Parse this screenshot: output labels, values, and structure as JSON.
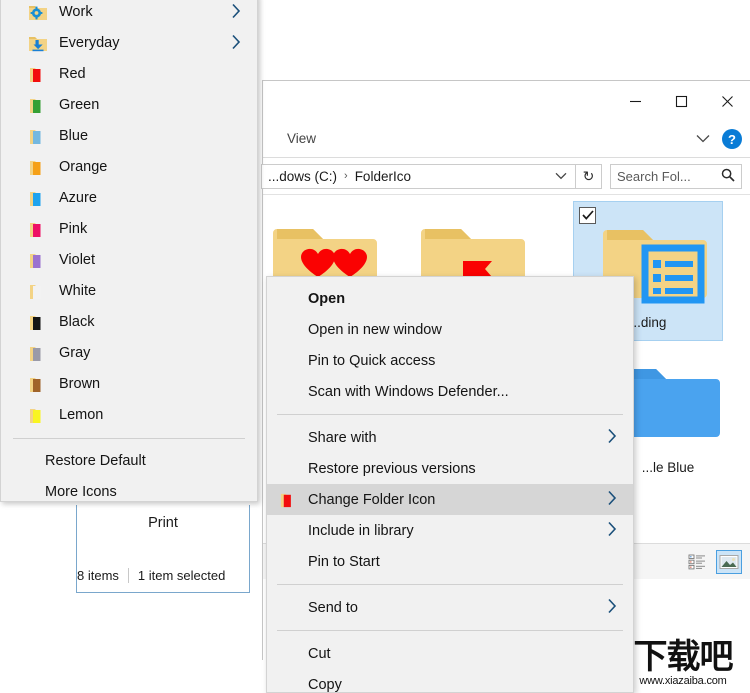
{
  "explorer": {
    "window_buttons": {
      "minimize": "minimize",
      "maximize": "maximize",
      "close": "close"
    },
    "ribbon": {
      "tab_view": "View",
      "help_label": "?"
    },
    "address": {
      "crumb1": "...dows (C:)",
      "crumb2": "FolderIco",
      "separator": "›",
      "refresh_label": "↻"
    },
    "search": {
      "placeholder": "Search Fol...",
      "icon": "search-icon"
    },
    "files": [
      {
        "label": "",
        "icon": "folder-heart-red",
        "selected": false
      },
      {
        "label": "",
        "icon": "folder-flag-red",
        "selected": false
      },
      {
        "label": "...ding",
        "icon": "folder-reading-blue",
        "selected": true
      },
      {
        "label": "...le Blue",
        "icon": "folder-plain-blue",
        "selected": false
      }
    ],
    "status": {
      "item_count": "8 items",
      "selection": "1 item selected"
    },
    "view_buttons": {
      "details_view": "details-view-icon",
      "large_icons_view": "large-icons-view-icon"
    }
  },
  "left_menu": {
    "items": [
      {
        "label": "Work",
        "icon": "folder-gear-yellow",
        "color": "#2f8fd4",
        "submenu": true
      },
      {
        "label": "Everyday",
        "icon": "folder-download",
        "color": "#1a7fd4",
        "submenu": true
      },
      {
        "label": "Red",
        "icon": "folder-color",
        "color": "#f20d0d",
        "submenu": false
      },
      {
        "label": "Green",
        "icon": "folder-color",
        "color": "#35a035",
        "submenu": false
      },
      {
        "label": "Blue",
        "icon": "folder-color",
        "color": "#74b8e0",
        "submenu": false
      },
      {
        "label": "Orange",
        "icon": "folder-color",
        "color": "#f5a017",
        "submenu": false
      },
      {
        "label": "Azure",
        "icon": "folder-color",
        "color": "#1fa3ee",
        "submenu": false
      },
      {
        "label": "Pink",
        "icon": "folder-color",
        "color": "#ee1064",
        "submenu": false
      },
      {
        "label": "Violet",
        "icon": "folder-color",
        "color": "#9b72d0",
        "submenu": false
      },
      {
        "label": "White",
        "icon": "folder-color",
        "color": "#f2f2f2",
        "submenu": false
      },
      {
        "label": "Black",
        "icon": "folder-color",
        "color": "#141414",
        "submenu": false
      },
      {
        "label": "Gray",
        "icon": "folder-color",
        "color": "#9a9aa8",
        "submenu": false
      },
      {
        "label": "Brown",
        "icon": "folder-color",
        "color": "#a0632a",
        "submenu": false
      },
      {
        "label": "Lemon",
        "icon": "folder-color",
        "color": "#f9f520",
        "submenu": false
      }
    ],
    "footer_items": [
      {
        "label": "Restore Default"
      },
      {
        "label": "More Icons"
      }
    ]
  },
  "behind_window": {
    "print_label": "Print",
    "item_count": "8 items",
    "selection": "1 item selected"
  },
  "context_menu": {
    "groups": [
      {
        "items": [
          {
            "label": "Open",
            "bold": true,
            "submenu": false,
            "icon": null,
            "highlighted": false
          },
          {
            "label": "Open in new window",
            "bold": false,
            "submenu": false,
            "icon": null,
            "highlighted": false
          },
          {
            "label": "Pin to Quick access",
            "bold": false,
            "submenu": false,
            "icon": null,
            "highlighted": false
          },
          {
            "label": "Scan with Windows Defender...",
            "bold": false,
            "submenu": false,
            "icon": null,
            "highlighted": false
          }
        ]
      },
      {
        "items": [
          {
            "label": "Share with",
            "bold": false,
            "submenu": true,
            "icon": null,
            "highlighted": false
          },
          {
            "label": "Restore previous versions",
            "bold": false,
            "submenu": false,
            "icon": null,
            "highlighted": false
          },
          {
            "label": "Change Folder Icon",
            "bold": false,
            "submenu": true,
            "icon": "folder-red-icon",
            "highlighted": true
          },
          {
            "label": "Include in library",
            "bold": false,
            "submenu": true,
            "icon": null,
            "highlighted": false
          },
          {
            "label": "Pin to Start",
            "bold": false,
            "submenu": false,
            "icon": null,
            "highlighted": false
          }
        ]
      },
      {
        "items": [
          {
            "label": "Send to",
            "bold": false,
            "submenu": true,
            "icon": null,
            "highlighted": false
          }
        ]
      },
      {
        "items": [
          {
            "label": "Cut",
            "bold": false,
            "submenu": false,
            "icon": null,
            "highlighted": false
          },
          {
            "label": "Copy",
            "bold": false,
            "submenu": false,
            "icon": null,
            "highlighted": false
          }
        ]
      }
    ]
  },
  "watermark": {
    "brand": "下载吧",
    "url": "www.xiazaiba.com"
  },
  "colors": {
    "menu_bg": "#f1f1f1",
    "highlight": "#d6d6d6",
    "selection_blue": "#cce4f7",
    "accent_blue": "#0a7cd6",
    "folder_yellow": "#f6d98c"
  }
}
